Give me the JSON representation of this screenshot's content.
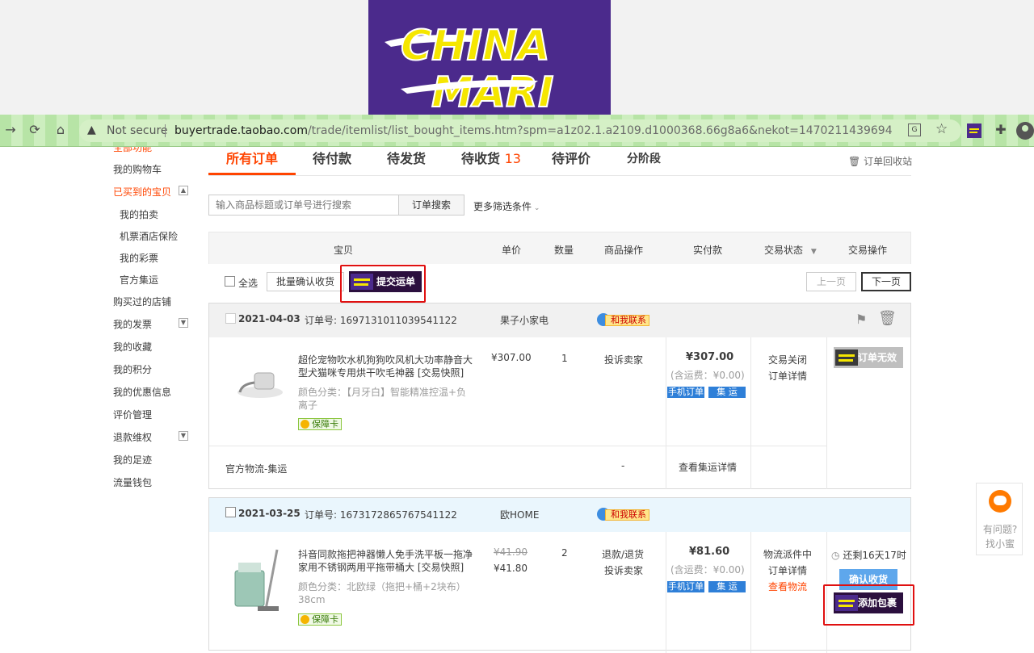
{
  "browser": {
    "security_label": "Not secure",
    "url_host": "buyertrade.taobao.com",
    "url_path": "/trade/itemlist/list_bought_items.htm?spm=a1z02.1.a2109.d1000368.66g8a6&nekot=1470211439694"
  },
  "sidebar": {
    "items": [
      {
        "label": "全部功能"
      },
      {
        "label": "我的购物车"
      },
      {
        "label": "已买到的宝贝"
      },
      {
        "label": "我的拍卖"
      },
      {
        "label": "机票酒店保险"
      },
      {
        "label": "我的彩票"
      },
      {
        "label": "官方集运"
      },
      {
        "label": "购买过的店铺"
      },
      {
        "label": "我的发票"
      },
      {
        "label": "我的收藏"
      },
      {
        "label": "我的积分"
      },
      {
        "label": "我的优惠信息"
      },
      {
        "label": "评价管理"
      },
      {
        "label": "退款维权"
      },
      {
        "label": "我的足迹"
      },
      {
        "label": "流量钱包"
      }
    ]
  },
  "tabs": [
    {
      "label": "所有订单"
    },
    {
      "label": "待付款"
    },
    {
      "label": "待发货"
    },
    {
      "label": "待收货",
      "count": "13"
    },
    {
      "label": "待评价"
    },
    {
      "label": "分阶段"
    }
  ],
  "recycle_label": "订单回收站",
  "search": {
    "placeholder": "输入商品标题或订单号进行搜索",
    "button": "订单搜索",
    "more": "更多筛选条件"
  },
  "table_header": [
    "宝贝",
    "单价",
    "数量",
    "商品操作",
    "实付款",
    "交易状态",
    "交易操作"
  ],
  "bulk": {
    "select_all": "全选",
    "confirm_receipt": "批量确认收货",
    "submit_waybill": "提交运单",
    "prev_page": "上一页",
    "next_page": "下一页"
  },
  "orders": [
    {
      "date": "2021-04-03",
      "order_label": "订单号:",
      "order_no": "1697131011039541122",
      "shop": "果子小家电",
      "contact": "和我联系",
      "title": "超伦宠物吹水机狗狗吹风机大功率静音大型犬猫咪专用烘干吹毛神器 [交易快照]",
      "attr": "颜色分类：【月牙白】智能精准控温+负离子",
      "guarantee": "保障卡",
      "price": "¥307.00",
      "qty": "1",
      "item_action": "投诉卖家",
      "paid": "¥307.00",
      "shipping": "(含运费：¥0.00)",
      "tag_mobile": "手机订单",
      "tag_consolidate": "集 运",
      "status": "交易关闭",
      "status_detail": "订单详情",
      "action": "订单无效",
      "logistics": "官方物流-集运",
      "logistics_dash": "-",
      "logistics_detail": "查看集运详情"
    },
    {
      "date": "2021-03-25",
      "order_label": "订单号:",
      "order_no": "1673172865767541122",
      "shop": "欧HOME",
      "contact": "和我联系",
      "title": "抖音同款拖把神器懒人免手洗平板一拖净家用不锈钢两用平拖带桶大 [交易快照]",
      "attr": "颜色分类：北欧绿（拖把+桶+2块布）38cm",
      "guarantee": "保障卡",
      "price_old": "¥41.90",
      "price": "¥41.80",
      "qty": "2",
      "item_action_1": "退款/退货",
      "item_action_2": "投诉卖家",
      "paid": "¥81.60",
      "shipping": "(含运费：¥0.00)",
      "tag_mobile": "手机订单",
      "tag_consolidate": "集 运",
      "status": "物流派件中",
      "status_detail": "订单详情",
      "status_logistics": "查看物流",
      "remaining": "还剩16天17时",
      "confirm": "确认收货",
      "add_package": "添加包裹"
    }
  ],
  "helper": {
    "line1": "有问题?",
    "line2": "找小蜜"
  },
  "colors": {
    "accent": "#ff4400",
    "brand_purple": "#4b2a8c",
    "brand_yellow": "#f5e600",
    "highlight_box": "#e01010"
  }
}
